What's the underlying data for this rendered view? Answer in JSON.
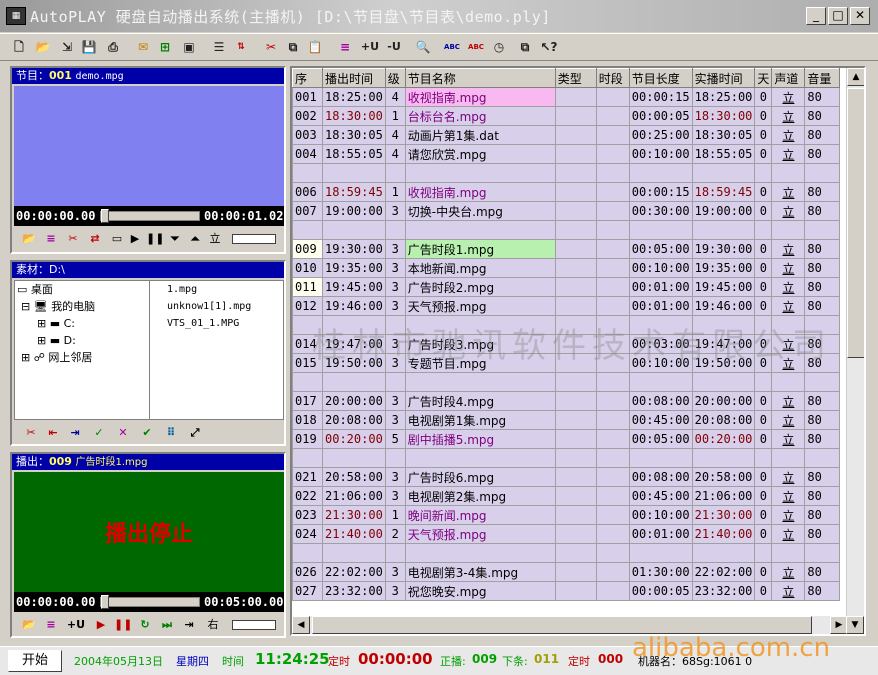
{
  "window": {
    "title": "AutoPLAY 硬盘自动播出系统(主播机)  [D:\\节目盘\\节目表\\demo.ply]"
  },
  "toolbar": {
    "btn_add": "+U",
    "btn_sub": "-U",
    "btn_abc1": "ABC",
    "btn_abc2": "ABC"
  },
  "program_panel": {
    "label": "节目：",
    "num": "001",
    "file": "demo.mpg",
    "time_current": "00:00:00.00",
    "time_total": "00:00:01.02",
    "ctl_label": "立"
  },
  "material_panel": {
    "label": "素材：D:\\",
    "tree": [
      "桌面",
      "我的电脑",
      "C:",
      "D:",
      "网上邻居"
    ],
    "files": [
      "1.mpg",
      "unknow1[1].mpg",
      "VTS_01_1.MPG"
    ]
  },
  "playout_panel": {
    "label": "播出：",
    "num": "009",
    "file": "广告时段1.mpg",
    "status": "播出停止",
    "time_current": "00:00:00.00",
    "time_total": "00:05:00.00",
    "btn_add": "+U",
    "ctl_label": "右"
  },
  "table": {
    "headers": [
      "序",
      "播出时间",
      "级",
      "节目名称",
      "类型",
      "时段",
      "节目长度",
      "实播时间",
      "天",
      "声道",
      "音量"
    ],
    "rows": [
      {
        "seq": "001",
        "time": "18:25:00",
        "lvl": "4",
        "name": "收视指南.mpg",
        "len": "00:00:15",
        "actual": "18:25:00",
        "day": "0",
        "ch": "立",
        "vol": "80",
        "tc": "#000",
        "nc": "#800080",
        "hl": "#f8b8f0"
      },
      {
        "seq": "002",
        "time": "18:30:00",
        "lvl": "1",
        "name": "台标台名.mpg",
        "len": "00:00:05",
        "actual": "18:30:00",
        "day": "0",
        "ch": "立",
        "vol": "80",
        "tc": "#800000",
        "nc": "#800080",
        "hl": ""
      },
      {
        "seq": "003",
        "time": "18:30:05",
        "lvl": "4",
        "name": "动画片第1集.dat",
        "len": "00:25:00",
        "actual": "18:30:05",
        "day": "0",
        "ch": "立",
        "vol": "80",
        "tc": "#000",
        "nc": "#000",
        "hl": ""
      },
      {
        "seq": "004",
        "time": "18:55:05",
        "lvl": "4",
        "name": "请您欣赏.mpg",
        "len": "00:10:00",
        "actual": "18:55:05",
        "day": "0",
        "ch": "立",
        "vol": "80",
        "tc": "#000",
        "nc": "#000",
        "hl": ""
      },
      {
        "seq": "",
        "time": "",
        "lvl": "",
        "name": "",
        "len": "",
        "actual": "",
        "day": "",
        "ch": "",
        "vol": "",
        "tc": "#000",
        "nc": "#000",
        "hl": ""
      },
      {
        "seq": "006",
        "time": "18:59:45",
        "lvl": "1",
        "name": "收视指南.mpg",
        "len": "00:00:15",
        "actual": "18:59:45",
        "day": "0",
        "ch": "立",
        "vol": "80",
        "tc": "#800000",
        "nc": "#800080",
        "hl": ""
      },
      {
        "seq": "007",
        "time": "19:00:00",
        "lvl": "3",
        "name": "切换-中央台.mpg",
        "len": "00:30:00",
        "actual": "19:00:00",
        "day": "0",
        "ch": "立",
        "vol": "80",
        "tc": "#000",
        "nc": "#000",
        "hl": ""
      },
      {
        "seq": "",
        "time": "",
        "lvl": "",
        "name": "",
        "len": "",
        "actual": "",
        "day": "",
        "ch": "",
        "vol": "",
        "tc": "#000",
        "nc": "#000",
        "hl": ""
      },
      {
        "seq": "009",
        "time": "19:30:00",
        "lvl": "3",
        "name": "广告时段1.mpg",
        "len": "00:05:00",
        "actual": "19:30:00",
        "day": "0",
        "ch": "立",
        "vol": "80",
        "tc": "#000",
        "nc": "#000",
        "hl": "#b8f0b0"
      },
      {
        "seq": "010",
        "time": "19:35:00",
        "lvl": "3",
        "name": "本地新闻.mpg",
        "len": "00:10:00",
        "actual": "19:35:00",
        "day": "0",
        "ch": "立",
        "vol": "80",
        "tc": "#000",
        "nc": "#000",
        "hl": ""
      },
      {
        "seq": "011",
        "time": "19:45:00",
        "lvl": "3",
        "name": "广告时段2.mpg",
        "len": "00:01:00",
        "actual": "19:45:00",
        "day": "0",
        "ch": "立",
        "vol": "80",
        "tc": "#000",
        "nc": "#000",
        "hl": ""
      },
      {
        "seq": "012",
        "time": "19:46:00",
        "lvl": "3",
        "name": "天气预报.mpg",
        "len": "00:01:00",
        "actual": "19:46:00",
        "day": "0",
        "ch": "立",
        "vol": "80",
        "tc": "#000",
        "nc": "#000",
        "hl": ""
      },
      {
        "seq": "",
        "time": "",
        "lvl": "",
        "name": "",
        "len": "",
        "actual": "",
        "day": "",
        "ch": "",
        "vol": "",
        "tc": "#000",
        "nc": "#000",
        "hl": ""
      },
      {
        "seq": "014",
        "time": "19:47:00",
        "lvl": "3",
        "name": "广告时段3.mpg",
        "len": "00:03:00",
        "actual": "19:47:00",
        "day": "0",
        "ch": "立",
        "vol": "80",
        "tc": "#000",
        "nc": "#000",
        "hl": ""
      },
      {
        "seq": "015",
        "time": "19:50:00",
        "lvl": "3",
        "name": "专题节目.mpg",
        "len": "00:10:00",
        "actual": "19:50:00",
        "day": "0",
        "ch": "立",
        "vol": "80",
        "tc": "#000",
        "nc": "#000",
        "hl": ""
      },
      {
        "seq": "",
        "time": "",
        "lvl": "",
        "name": "",
        "len": "",
        "actual": "",
        "day": "",
        "ch": "",
        "vol": "",
        "tc": "#000",
        "nc": "#000",
        "hl": ""
      },
      {
        "seq": "017",
        "time": "20:00:00",
        "lvl": "3",
        "name": "广告时段4.mpg",
        "len": "00:08:00",
        "actual": "20:00:00",
        "day": "0",
        "ch": "立",
        "vol": "80",
        "tc": "#000",
        "nc": "#000",
        "hl": ""
      },
      {
        "seq": "018",
        "time": "20:08:00",
        "lvl": "3",
        "name": "电视剧第1集.mpg",
        "len": "00:45:00",
        "actual": "20:08:00",
        "day": "0",
        "ch": "立",
        "vol": "80",
        "tc": "#000",
        "nc": "#000",
        "hl": ""
      },
      {
        "seq": "019",
        "time": "00:20:00",
        "lvl": "5",
        "name": "剧中插播5.mpg",
        "len": "00:05:00",
        "actual": "00:20:00",
        "day": "0",
        "ch": "立",
        "vol": "80",
        "tc": "#800000",
        "nc": "#800080",
        "hl": ""
      },
      {
        "seq": "",
        "time": "",
        "lvl": "",
        "name": "",
        "len": "",
        "actual": "",
        "day": "",
        "ch": "",
        "vol": "",
        "tc": "#000",
        "nc": "#000",
        "hl": ""
      },
      {
        "seq": "021",
        "time": "20:58:00",
        "lvl": "3",
        "name": "广告时段6.mpg",
        "len": "00:08:00",
        "actual": "20:58:00",
        "day": "0",
        "ch": "立",
        "vol": "80",
        "tc": "#000",
        "nc": "#000",
        "hl": ""
      },
      {
        "seq": "022",
        "time": "21:06:00",
        "lvl": "3",
        "name": "电视剧第2集.mpg",
        "len": "00:45:00",
        "actual": "21:06:00",
        "day": "0",
        "ch": "立",
        "vol": "80",
        "tc": "#000",
        "nc": "#000",
        "hl": ""
      },
      {
        "seq": "023",
        "time": "21:30:00",
        "lvl": "1",
        "name": "晚间新闻.mpg",
        "len": "00:10:00",
        "actual": "21:30:00",
        "day": "0",
        "ch": "立",
        "vol": "80",
        "tc": "#800000",
        "nc": "#800080",
        "hl": ""
      },
      {
        "seq": "024",
        "time": "21:40:00",
        "lvl": "2",
        "name": "天气预报.mpg",
        "len": "00:01:00",
        "actual": "21:40:00",
        "day": "0",
        "ch": "立",
        "vol": "80",
        "tc": "#800000",
        "nc": "#800080",
        "hl": ""
      },
      {
        "seq": "",
        "time": "",
        "lvl": "",
        "name": "",
        "len": "",
        "actual": "",
        "day": "",
        "ch": "",
        "vol": "",
        "tc": "#000",
        "nc": "#000",
        "hl": ""
      },
      {
        "seq": "026",
        "time": "22:02:00",
        "lvl": "3",
        "name": "电视剧第3-4集.mpg",
        "len": "01:30:00",
        "actual": "22:02:00",
        "day": "0",
        "ch": "立",
        "vol": "80",
        "tc": "#000",
        "nc": "#000",
        "hl": ""
      },
      {
        "seq": "027",
        "time": "23:32:00",
        "lvl": "3",
        "name": "祝您晚安.mpg",
        "len": "00:00:05",
        "actual": "23:32:00",
        "day": "0",
        "ch": "立",
        "vol": "80",
        "tc": "#000",
        "nc": "#000",
        "hl": ""
      }
    ]
  },
  "watermark": "桂林市驰讯软件技术有限公司",
  "status": {
    "start": "开始",
    "date": "2004年05月13日",
    "weekday": "星期四",
    "time_label": "时间",
    "time": "11:24:25",
    "timer_label": "定时",
    "timer": "00:00:00",
    "playing_label": "正播:",
    "playing": "009",
    "next_label": "下条:",
    "next": "011",
    "timer2_label": "定时",
    "timer2": "000",
    "machine": "机器名：68Sg:1061 0",
    "site_mark": "alibaba.com.cn"
  }
}
